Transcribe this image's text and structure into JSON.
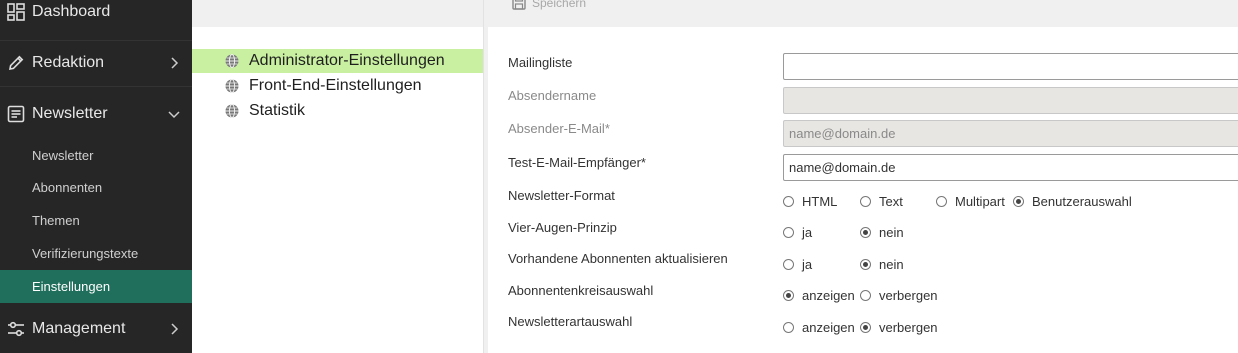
{
  "sidebar": {
    "dashboard": "Dashboard",
    "redaktion": "Redaktion",
    "newsletter": "Newsletter",
    "sub_items": [
      "Newsletter",
      "Abonnenten",
      "Themen",
      "Verifizierungstexte",
      "Einstellungen"
    ],
    "active_sub": "Einstellungen",
    "management": "Management"
  },
  "toolbar": {
    "save_label": "Speichern"
  },
  "tree": {
    "items": [
      "Administrator-Einstellungen",
      "Front-End-Einstellungen",
      "Statistik"
    ],
    "selected": "Administrator-Einstellungen"
  },
  "form": {
    "mailingliste": {
      "label": "Mailingliste",
      "value": ""
    },
    "absendername": {
      "label": "Absendername",
      "value": ""
    },
    "absender_email": {
      "label": "Absender-E-Mail*",
      "value": "name@domain.de"
    },
    "test_email": {
      "label": "Test-E-Mail-Empfänger*",
      "value": "name@domain.de"
    },
    "format": {
      "label": "Newsletter-Format",
      "options": [
        "HTML",
        "Text",
        "Multipart",
        "Benutzerauswahl"
      ],
      "selected": "Benutzerauswahl"
    },
    "vier_augen": {
      "label": "Vier-Augen-Prinzip",
      "options": [
        "ja",
        "nein"
      ],
      "selected": "nein"
    },
    "aktualisieren": {
      "label": "Vorhandene Abonnenten aktualisieren",
      "options": [
        "ja",
        "nein"
      ],
      "selected": "nein"
    },
    "kreisauswahl": {
      "label": "Abonnentenkreisauswahl",
      "options": [
        "anzeigen",
        "verbergen"
      ],
      "selected": "anzeigen"
    },
    "artauswahl": {
      "label": "Newsletterartauswahl",
      "options": [
        "anzeigen",
        "verbergen"
      ],
      "selected": "verbergen"
    }
  }
}
